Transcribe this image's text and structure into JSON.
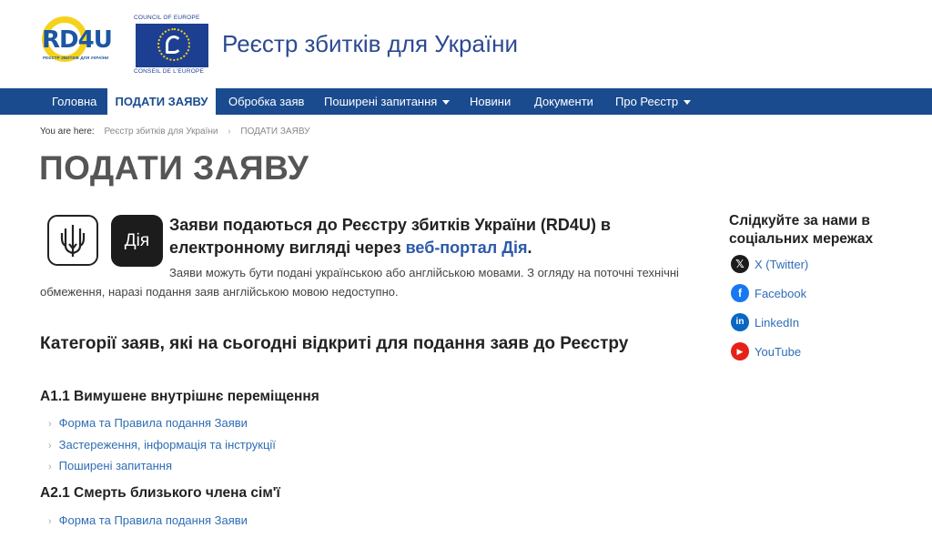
{
  "header": {
    "rd4u_logo_text": "RD4U",
    "rd4u_logo_sub": "РЕЄСТР ЗБИТКІВ ДЛЯ УКРАЇНИ",
    "coe_top": "COUNCIL OF EUROPE",
    "coe_bottom": "CONSEIL DE L'EUROPE",
    "site_title": "Реєстр збитків для України"
  },
  "nav": {
    "items": [
      {
        "label": "Головна"
      },
      {
        "label": "ПОДАТИ ЗАЯВУ"
      },
      {
        "label": "Обробка заяв"
      },
      {
        "label": "Поширені запитання"
      },
      {
        "label": "Новини"
      },
      {
        "label": "Документи"
      },
      {
        "label": "Про Реєстр"
      }
    ]
  },
  "breadcrumb": {
    "lead": "You are here:",
    "items": [
      "Реєстр збитків для України",
      "ПОДАТИ ЗАЯВУ"
    ]
  },
  "page_title": "ПОДАТИ ЗАЯВУ",
  "intro": {
    "diia_label": "Дія",
    "heading_text": "Заяви подаються до Реєстру збитків України (RD4U) в електронному вигляді через ",
    "heading_link": "веб-портал Дія",
    "heading_end": ".",
    "body": "Заяви можуть бути подані українською або англійською мовами. З огляду на поточні технічні обмеження, наразі подання заяв англійською мовою недоступно."
  },
  "categories": {
    "heading": "Категорії заяв, які на сьогодні відкриті для подання заяв до Реєстру",
    "groups": [
      {
        "title": "A1.1 Вимушене внутрішнє переміщення",
        "links": [
          "Форма та Правила подання Заяви",
          "Застереження, інформація та інструкції",
          "Поширені запитання"
        ]
      },
      {
        "title": "A2.1 Смерть близького члена сім'ї",
        "links": [
          "Форма та Правила подання Заяви"
        ]
      }
    ]
  },
  "sidebar": {
    "heading": "Слідкуйте за нами в соціальних мережах",
    "socials": [
      {
        "label": "X (Twitter)",
        "icon": "x-icon",
        "color": "#1c1c1c"
      },
      {
        "label": "Facebook",
        "icon": "facebook-icon",
        "color": "#1877f2"
      },
      {
        "label": "LinkedIn",
        "icon": "linkedin-icon",
        "color": "#0a66c2"
      },
      {
        "label": "YouTube",
        "icon": "youtube-icon",
        "color": "#e62117"
      }
    ]
  }
}
